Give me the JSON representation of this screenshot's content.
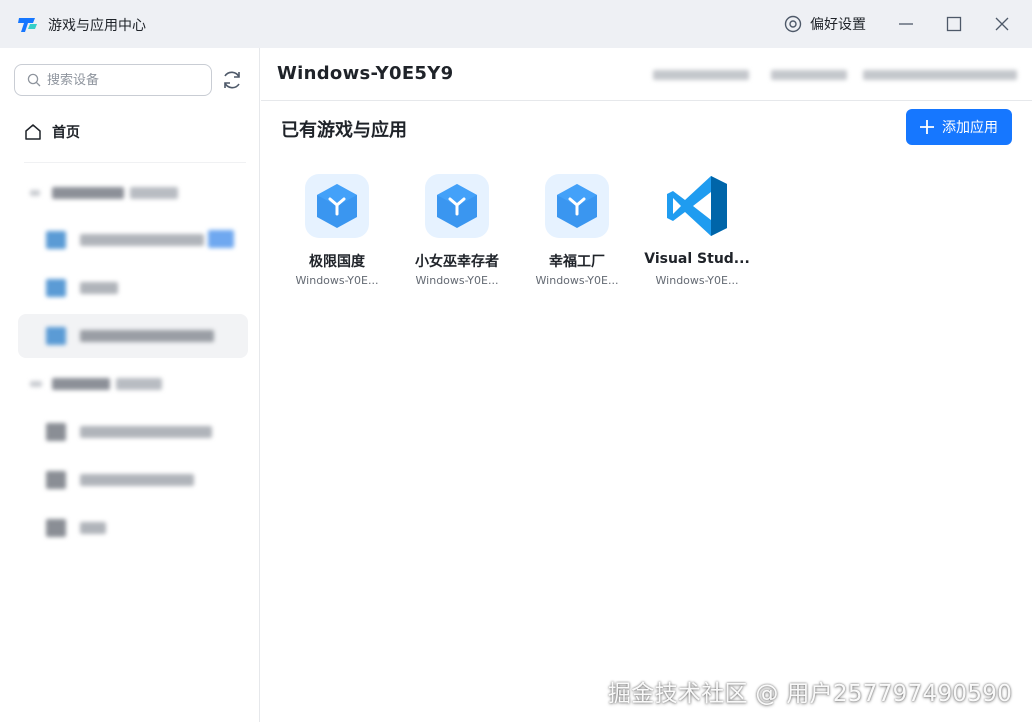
{
  "window": {
    "title": "游戏与应用中心",
    "preferences_label": "偏好设置"
  },
  "sidebar": {
    "search_placeholder": "搜索设备",
    "home_label": "首页"
  },
  "main": {
    "device_title": "Windows-Y0E5Y9",
    "section_title": "已有游戏与应用",
    "add_button_label": "添加应用",
    "apps": [
      {
        "name": "极限国度",
        "device": "Windows-Y0E...",
        "icon": "app-cube-icon"
      },
      {
        "name": "小女巫幸存者",
        "device": "Windows-Y0E...",
        "icon": "app-cube-icon"
      },
      {
        "name": "幸福工厂",
        "device": "Windows-Y0E...",
        "icon": "app-cube-icon"
      },
      {
        "name": "Visual Stud...",
        "device": "Windows-Y0E...",
        "icon": "vscode-icon"
      }
    ]
  },
  "watermark": "掘金技术社区 @ 用户257797490590",
  "colors": {
    "accent": "#1677ff",
    "titlebar_bg": "#eef0f4",
    "app_icon_bg": "#e6f2ff",
    "vscode_blue": "#0a7acc"
  }
}
